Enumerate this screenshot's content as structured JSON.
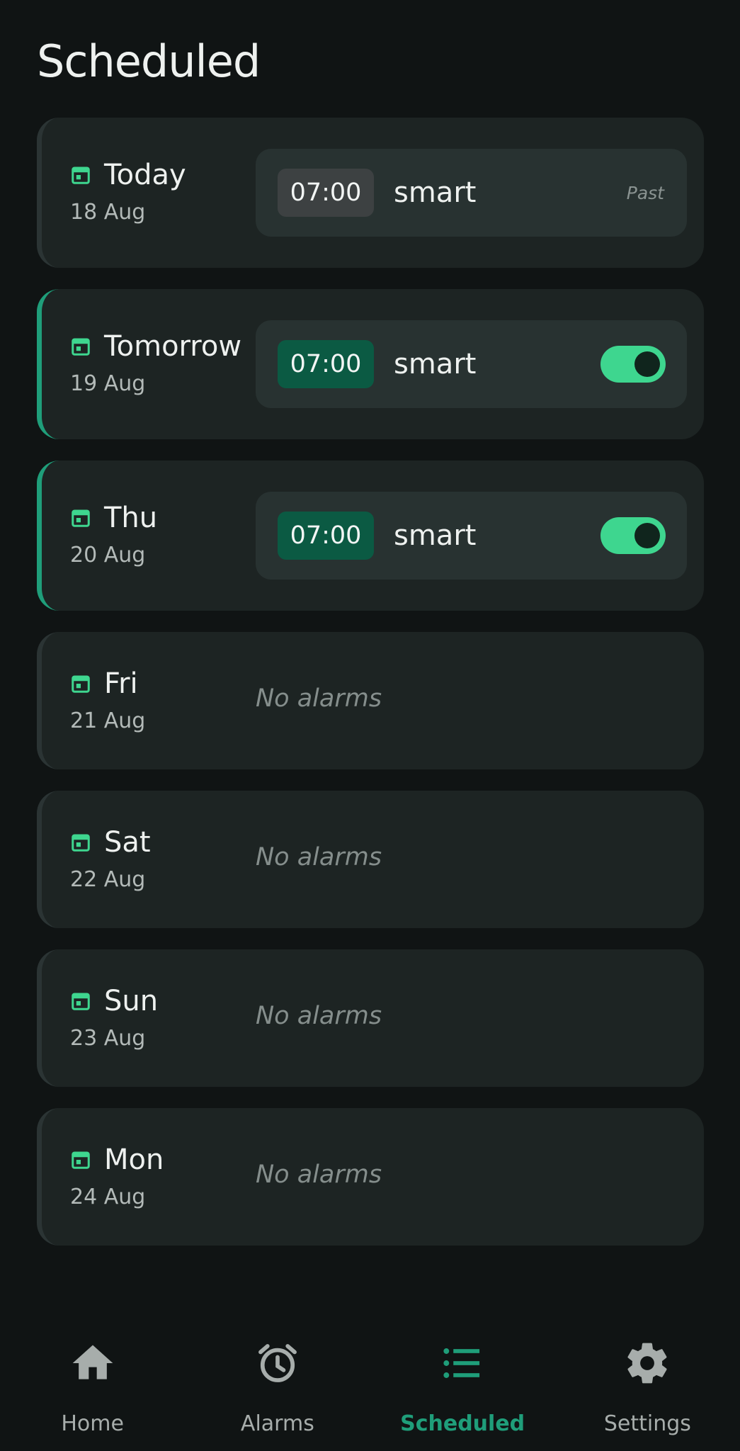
{
  "page": {
    "title": "Scheduled"
  },
  "colors": {
    "accent": "#1f9e7a",
    "toggle_on": "#3ed68f",
    "background": "#101414",
    "card": "#1d2423"
  },
  "days": [
    {
      "name": "Today",
      "date": "18 Aug",
      "alarm": {
        "time": "07:00",
        "label": "smart",
        "status": "Past",
        "enabled": false
      }
    },
    {
      "name": "Tomorrow",
      "date": "19 Aug",
      "alarm": {
        "time": "07:00",
        "label": "smart",
        "enabled": true
      }
    },
    {
      "name": "Thu",
      "date": "20 Aug",
      "alarm": {
        "time": "07:00",
        "label": "smart",
        "enabled": true
      }
    },
    {
      "name": "Fri",
      "date": "21 Aug",
      "empty_text": "No alarms"
    },
    {
      "name": "Sat",
      "date": "22 Aug",
      "empty_text": "No alarms"
    },
    {
      "name": "Sun",
      "date": "23 Aug",
      "empty_text": "No alarms"
    },
    {
      "name": "Mon",
      "date": "24 Aug",
      "empty_text": "No alarms"
    }
  ],
  "nav": {
    "items": [
      {
        "label": "Home",
        "icon": "home-icon",
        "active": false
      },
      {
        "label": "Alarms",
        "icon": "alarm-clock-icon",
        "active": false
      },
      {
        "label": "Scheduled",
        "icon": "list-icon",
        "active": true
      },
      {
        "label": "Settings",
        "icon": "gear-icon",
        "active": false
      }
    ]
  }
}
